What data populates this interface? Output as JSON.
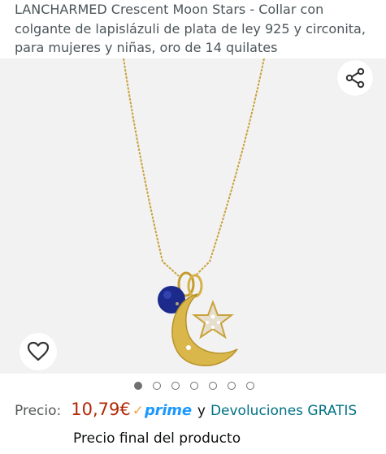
{
  "product": {
    "title": "LANCHARMED Crescent Moon Stars - Collar con colgante de lapislázuli de plata de ley 925 y circonita, para mujeres y niñas, oro de 14 quilates"
  },
  "gallery": {
    "image_count": 7,
    "active_index": 0,
    "share_icon": "share-icon",
    "wishlist_icon": "heart-icon",
    "background": "#f2f2f2"
  },
  "pricing": {
    "label": "Precio:",
    "price": "10,79€",
    "prime_check": "✓",
    "prime_label": "prime",
    "conjunction": "y",
    "returns_link": "Devoluciones GRATIS",
    "final_price_note": "Precio final del producto",
    "price_color": "#b12704",
    "link_color": "#007185",
    "prime_color": "#1a98ff"
  }
}
